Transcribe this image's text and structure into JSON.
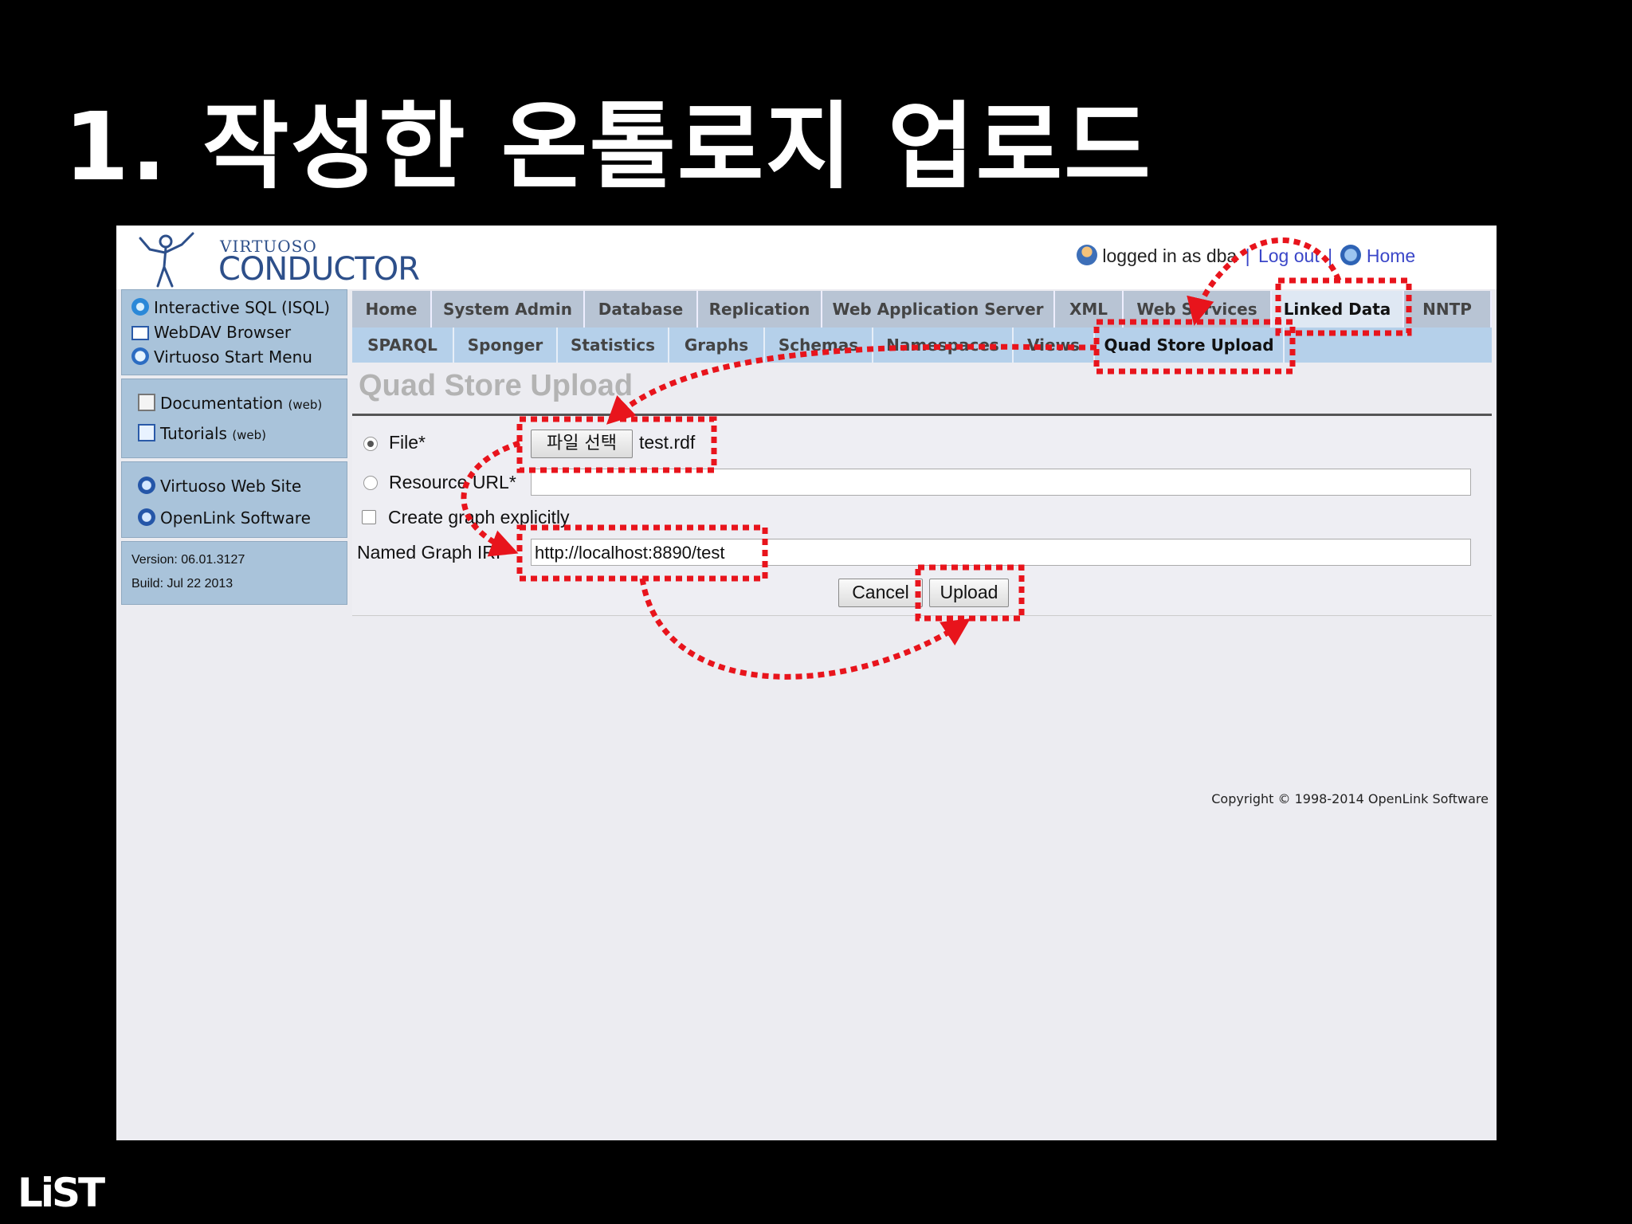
{
  "slide": {
    "title": "1. 작성한 온톨로지 업로드"
  },
  "header": {
    "logo_small": "VIRTUOSO",
    "logo_big": "CONDUCTOR",
    "logged_in_text": "logged in as dba",
    "logout_label": "Log out",
    "separator": "|",
    "home_label": "Home"
  },
  "sidebar": {
    "group1": [
      "Interactive SQL (ISQL)",
      "WebDAV Browser",
      "Virtuoso Start Menu"
    ],
    "group2": [
      {
        "label": "Documentation",
        "tag": "(web)"
      },
      {
        "label": "Tutorials",
        "tag": "(web)"
      }
    ],
    "group3": [
      "Virtuoso Web Site",
      "OpenLink Software"
    ],
    "version": "Version: 06.01.3127",
    "build": "Build: Jul 22 2013"
  },
  "tabs": [
    "Home",
    "System Admin",
    "Database",
    "Replication",
    "Web Application Server",
    "XML",
    "Web Services",
    "Linked Data",
    "NNTP"
  ],
  "active_tab": "Linked Data",
  "subtabs": [
    "SPARQL",
    "Sponger",
    "Statistics",
    "Graphs",
    "Schemas",
    "Namespaces",
    "Views",
    "Quad Store Upload"
  ],
  "active_subtab": "Quad Store Upload",
  "form": {
    "heading": "Quad Store Upload",
    "file_label": "File*",
    "file_button": "파일 선택",
    "file_name": "test.rdf",
    "resource_url_label": "Resource URL*",
    "resource_url_value": "",
    "create_graph_label": "Create graph explicitly",
    "named_graph_label": "Named Graph IRI*",
    "named_graph_value": "http://localhost:8890/test",
    "cancel_label": "Cancel",
    "upload_label": "Upload",
    "file_selected": true,
    "create_graph_checked": false
  },
  "footer": {
    "copyright": "Copyright © 1998-2014 OpenLink Software"
  },
  "brand": {
    "logo_text": "LiST"
  },
  "colors": {
    "annotation": "#e8141c",
    "tab_bg": "#b8c4d4",
    "subtab_bg": "#b5d0ea",
    "sidebar_bg": "#a9c3da",
    "link": "#3a46c8"
  }
}
